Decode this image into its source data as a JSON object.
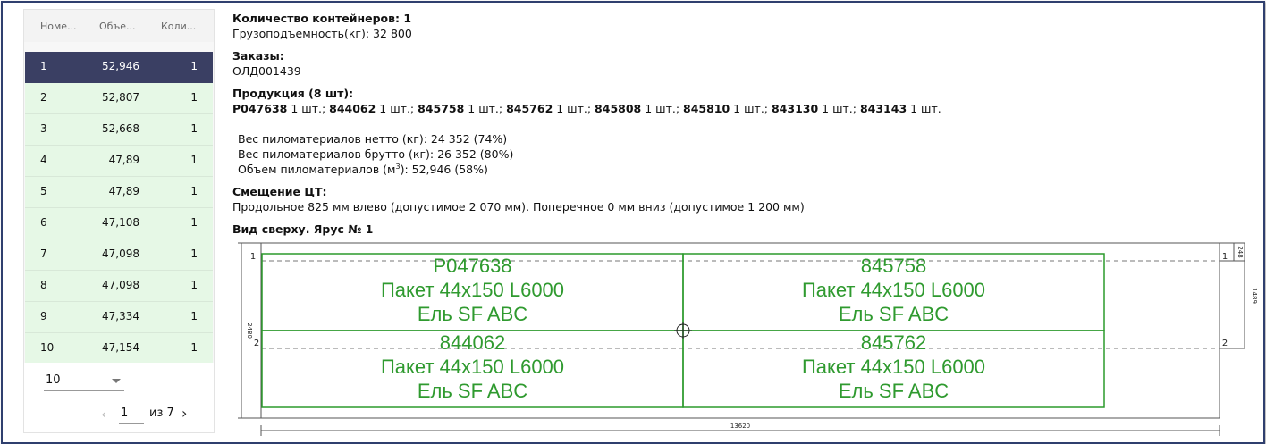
{
  "table": {
    "headers": [
      "Номе...",
      "Объе...",
      "Коли..."
    ],
    "rows": [
      {
        "num": "1",
        "volume": "52,946",
        "count": "1",
        "selected": true
      },
      {
        "num": "2",
        "volume": "52,807",
        "count": "1"
      },
      {
        "num": "3",
        "volume": "52,668",
        "count": "1"
      },
      {
        "num": "4",
        "volume": "47,89",
        "count": "1"
      },
      {
        "num": "5",
        "volume": "47,89",
        "count": "1"
      },
      {
        "num": "6",
        "volume": "47,108",
        "count": "1"
      },
      {
        "num": "7",
        "volume": "47,098",
        "count": "1"
      },
      {
        "num": "8",
        "volume": "47,098",
        "count": "1"
      },
      {
        "num": "9",
        "volume": "47,334",
        "count": "1"
      },
      {
        "num": "10",
        "volume": "47,154",
        "count": "1"
      }
    ]
  },
  "pagination": {
    "page_size": "10",
    "prev_icon": "‹",
    "current_page": "1",
    "of_text": "из 7",
    "next_icon": "›"
  },
  "info": {
    "containers_label": "Количество контейнеров: 1",
    "capacity": "Грузоподъемность(кг): 32 800",
    "orders_label": "Заказы:",
    "order_id": "ОЛД001439",
    "products_label": "Продукция (8 шт):",
    "products": [
      {
        "code": "P047638",
        "qty": " 1 шт.; "
      },
      {
        "code": "844062",
        "qty": " 1 шт.; "
      },
      {
        "code": "845758",
        "qty": " 1 шт.; "
      },
      {
        "code": "845762",
        "qty": " 1 шт.; "
      },
      {
        "code": "845808",
        "qty": " 1 шт.; "
      },
      {
        "code": "845810",
        "qty": " 1 шт.; "
      },
      {
        "code": "843130",
        "qty": " 1 шт.; "
      },
      {
        "code": "843143",
        "qty": " 1 шт."
      }
    ],
    "weight_net": "Вес пиломатериалов нетто (кг): 24 352 (74%)",
    "weight_gross": "Вес пиломатериалов брутто (кг): 26 352 (80%)",
    "volume_prefix": "Объем пиломатериалов (м",
    "volume_sup": "3",
    "volume_suffix": "): 52,946 (58%)",
    "cg_label": "Смещение ЦТ:",
    "cg_text": "Продольное 825 мм влево (допустимое 2 070 мм). Поперечное 0 мм вниз (допустимое 1 200 мм)",
    "view_label": "Вид сверху. Ярус № 1"
  },
  "diagram": {
    "packages": [
      {
        "code": "P047638",
        "name": "Пакет 44x150 L6000",
        "species": "Ель SF ABC"
      },
      {
        "code": "845758",
        "name": "Пакет 44x150 L6000",
        "species": "Ель SF ABC"
      },
      {
        "code": "844062",
        "name": "Пакет 44x150 L6000",
        "species": "Ель SF ABC"
      },
      {
        "code": "845762",
        "name": "Пакет 44x150 L6000",
        "species": "Ель SF ABC"
      }
    ],
    "row_labels_left": [
      "1",
      "2"
    ],
    "row_labels_right": [
      "1",
      "2"
    ],
    "width_dim": "2480",
    "length_dim": "13620",
    "right_dim_top": "248",
    "right_dim_main": "1489",
    "color": "#2c9a2c"
  }
}
